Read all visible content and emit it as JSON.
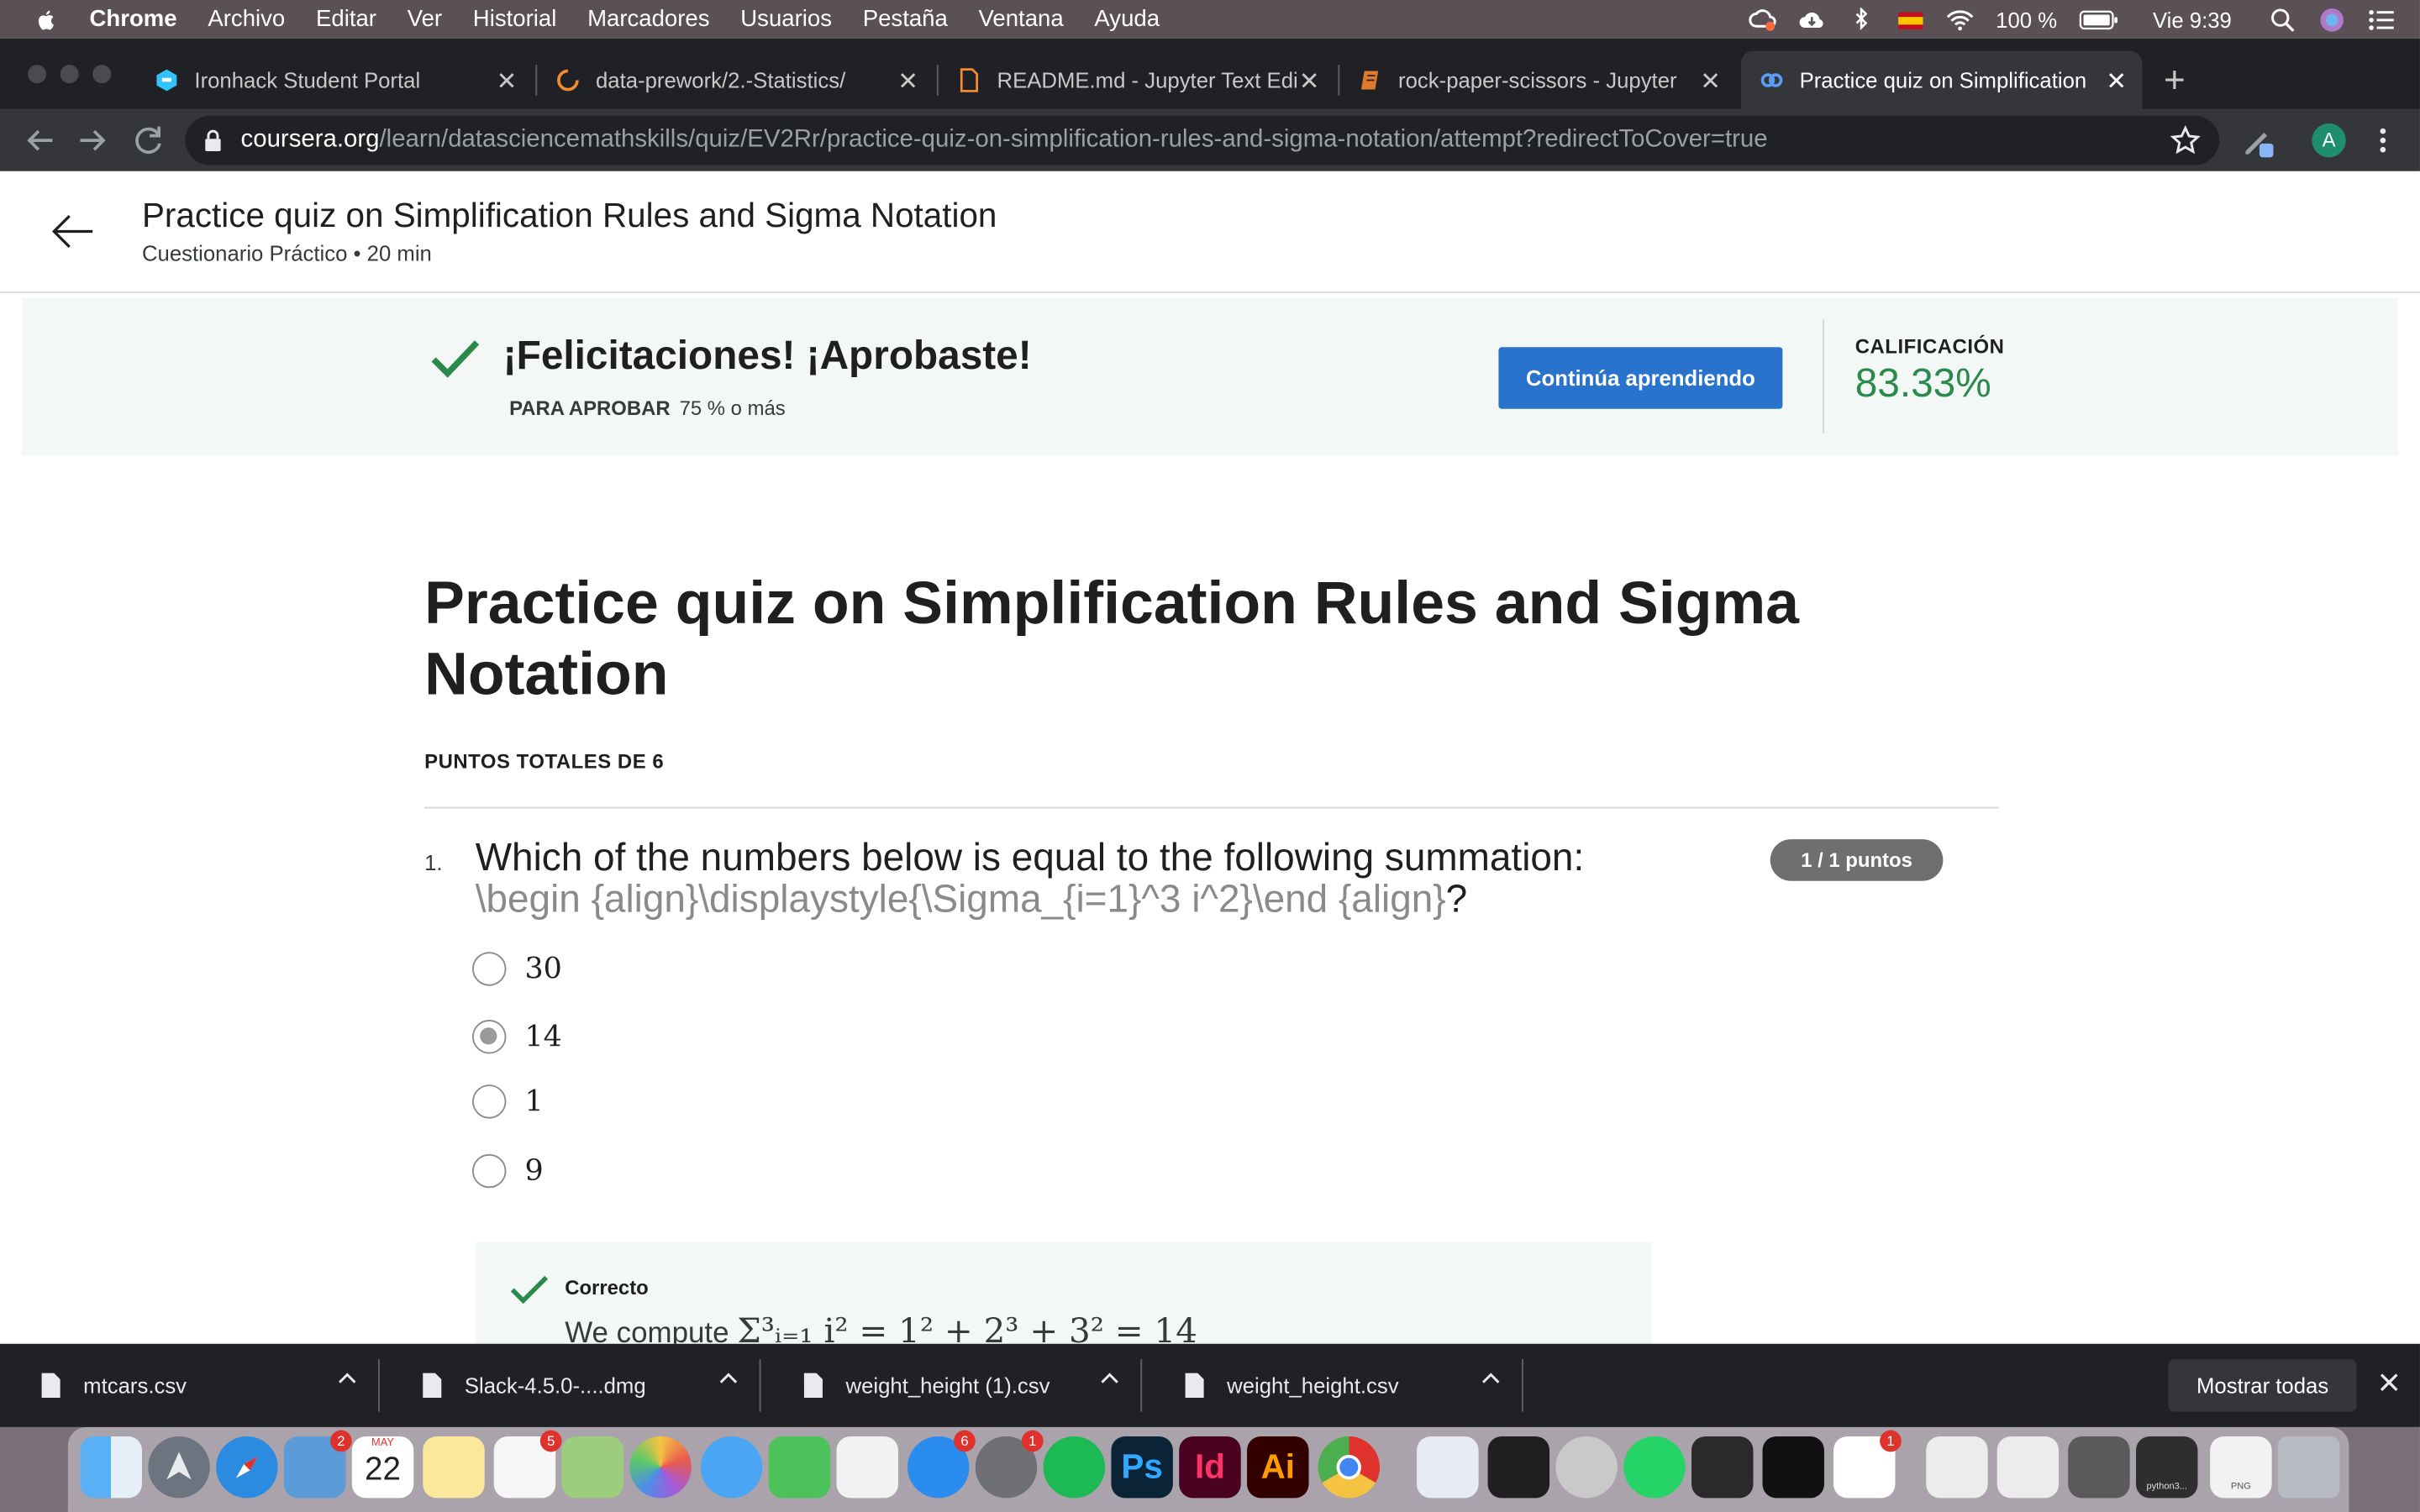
{
  "menubar": {
    "app": "Chrome",
    "items": [
      "Archivo",
      "Editar",
      "Ver",
      "Historial",
      "Marcadores",
      "Usuarios",
      "Pestaña",
      "Ventana",
      "Ayuda"
    ],
    "battery": "100 %",
    "clock": "Vie 9:39"
  },
  "tabs": [
    {
      "label": "Ironhack Student Portal",
      "icon": "ironhack-icon"
    },
    {
      "label": "data-prework/2.-Statistics/",
      "icon": "loading-spinner-icon"
    },
    {
      "label": "README.md - Jupyter Text Edi",
      "icon": "file-icon"
    },
    {
      "label": "rock-paper-scissors - Jupyter",
      "icon": "notebook-icon"
    },
    {
      "label": "Practice quiz on Simplification",
      "icon": "coursera-icon"
    }
  ],
  "omnibox": {
    "host": "coursera.org",
    "path": "/learn/datasciencemathskills/quiz/EV2Rr/practice-quiz-on-simplification-rules-and-sigma-notation/attempt?redirectToCover=true"
  },
  "profile_initial": "A",
  "header": {
    "title": "Practice quiz on Simplification Rules and Sigma Notation",
    "subtitle": "Cuestionario Práctico • 20 min"
  },
  "banner": {
    "title": "¡Felicitaciones! ¡Aprobaste!",
    "pass_label": "PARA APROBAR",
    "pass_value": "75 % o más",
    "continue_label": "Continúa aprendiendo",
    "grade_label": "CALIFICACIÓN",
    "grade_value": "83.33%"
  },
  "quiz": {
    "title": "Practice quiz on Simplification Rules and Sigma Notation",
    "points_total": "PUNTOS TOTALES DE 6",
    "question": {
      "number": "1.",
      "text": "Which of the numbers below is equal to the following summation:",
      "latex": "\\begin {align}\\displaystyle{\\Sigma_{i=1}^3 i^2}\\end {align}",
      "suffix": "?",
      "points": "1 / 1 puntos",
      "options": [
        "30",
        "14",
        "1",
        "9"
      ],
      "selected": "14",
      "feedback_label": "Correcto",
      "feedback_prefix": "We compute",
      "feedback_math": "Σ³ᵢ₌₁ i² = 1² + 2³ + 3² = 14"
    }
  },
  "downloads": {
    "files": [
      "mtcars.csv",
      "Slack-4.5.0-....dmg",
      "weight_height (1).csv",
      "weight_height.csv"
    ],
    "show_all": "Mostrar todas"
  },
  "dock": {
    "calendar_month": "MAY",
    "calendar_day": "22",
    "badges": {
      "mail": "2",
      "reminders": "5",
      "appstore": "6",
      "prefs": "1",
      "slack": "1"
    },
    "app_labels": {
      "photoshop": "Ps",
      "indesign": "Id",
      "illustrator": "Ai"
    },
    "file_label": "python3...",
    "png_label": "PNG"
  },
  "colors": {
    "accent": "#2a73cc",
    "success": "#2a8a4c",
    "banner_bg": "#f3f8f6"
  }
}
